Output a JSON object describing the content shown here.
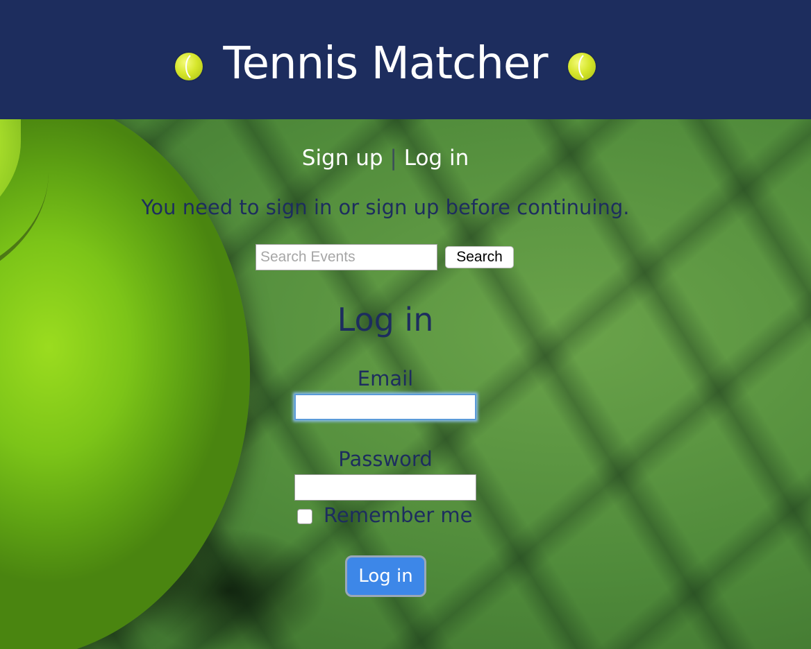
{
  "header": {
    "brand_title": "Tennis Matcher",
    "brand_icon": "tennis-ball-icon"
  },
  "nav": {
    "sign_up_label": "Sign up",
    "separator": "|",
    "log_in_label": "Log in"
  },
  "flash": {
    "notice": "You need to sign in or sign up before continuing."
  },
  "search": {
    "placeholder": "Search Events",
    "value": "",
    "button_label": "Search"
  },
  "login_form": {
    "title": "Log in",
    "email_label": "Email",
    "email_value": "",
    "password_label": "Password",
    "password_value": "",
    "remember_label": "Remember me",
    "remember_checked": false,
    "submit_label": "Log in"
  },
  "colors": {
    "header_bg": "#1d2d5e",
    "text_navy": "#1d2d5e",
    "button_blue": "#3d87e8"
  }
}
